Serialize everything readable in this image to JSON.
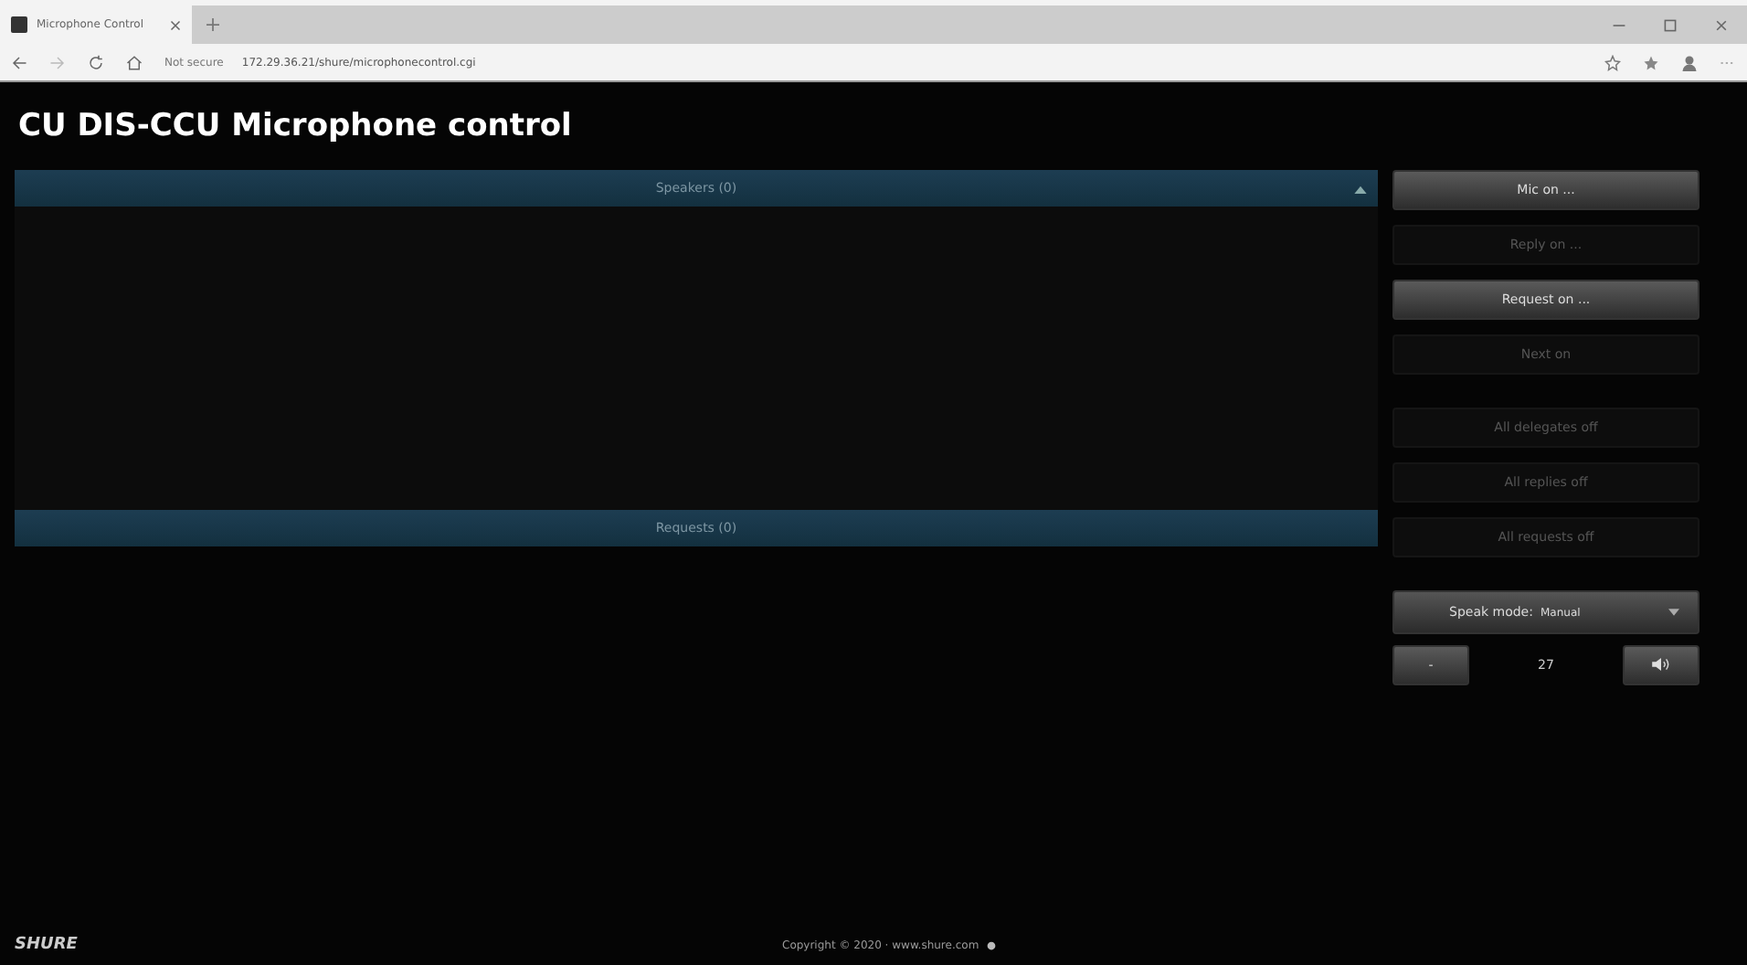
{
  "browser": {
    "tab_title": "Microphone Control",
    "security": "Not secure",
    "url": "172.29.36.21/shure/microphonecontrol.cgi"
  },
  "page_title": "CU DIS-CCU Microphone control",
  "lists": [
    {
      "label": "Speakers (0)",
      "collapsible": true
    },
    {
      "label": "Requests (0)",
      "collapsible": false
    }
  ],
  "buttons": [
    {
      "label": "Mic on ...",
      "disabled": false
    },
    {
      "label": "Reply on ...",
      "disabled": true
    },
    {
      "label": "Request on ...",
      "disabled": false
    },
    {
      "label": "Next on",
      "disabled": true
    },
    {
      "label": "All delegates off",
      "disabled": true
    },
    {
      "label": "All replies off",
      "disabled": true
    },
    {
      "label": "All requests off",
      "disabled": true
    }
  ],
  "speak_mode": {
    "label": "Speak mode:",
    "value": "Manual"
  },
  "volume": {
    "minus": "-",
    "value": "27"
  },
  "footer": {
    "logo": "SHURE",
    "copyright": "Copyright © 2020 · www.shure.com"
  }
}
